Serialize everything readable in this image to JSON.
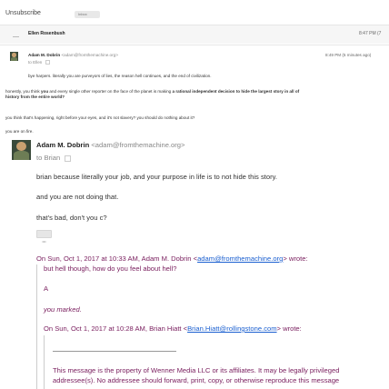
{
  "toolbar": {
    "unsubscribe_label": "Unsubscribe",
    "label_chip": "Inbox"
  },
  "collapsed_message": {
    "sender": "Ellen Rosenbush",
    "time": "8:47 PM (7"
  },
  "message1": {
    "sender": "Adam M. Dobrin",
    "email": "<adam@fromthemachine.org>",
    "time": "8:49 PM (5 minutes ago)",
    "to": "to Ellen",
    "body": "bye harpers. literally you are purveyors of lies, the reason hell continues, and the end of civilization."
  },
  "middle_text": {
    "p1a": "honestly, you think ",
    "p1b": "you",
    "p1c": " and every single other reporter on the face of the planet is making ",
    "p1d": "a rational independent decision to hide the largest story in all of",
    "p1e": "history from the entire world?",
    "p2": "you think that's happening, right before your eyes, and it's not slavery?  you should do nothing about it?",
    "p3": "you are on fire."
  },
  "message2": {
    "sender": "Adam M. Dobrin",
    "email": "<adam@fromthemachine.org>",
    "to": "to Brian",
    "lines": [
      "brian because literally your job, and your purpose in life is to not hide this story.",
      "and you are not doing that.",
      "that's bad, don't you c?"
    ],
    "expand": "•••"
  },
  "quoted": {
    "attr1_prefix": "On Sun, Oct 1, 2017 at 10:33 AM, Adam M. Dobrin <",
    "attr1_link": "adam@fromthemachine.org",
    "attr1_suffix": "> wrote:",
    "l1": "but hell though, how do you feel about hell?",
    "l2": "A",
    "l3": "you marked.",
    "attr2_prefix": "On Sun, Oct 1, 2017 at 10:28 AM, Brian Hiatt <",
    "attr2_link": "Brian.Hiatt@rollingstone.com",
    "attr2_suffix": "> wrote:",
    "disclaimer1": "This message is the property of Wenner Media LLC or its affiliates. It may be legally privileged",
    "disclaimer2": "addressee(s). No addressee should forward, print, copy, or otherwise reproduce this message"
  },
  "colors": {
    "link": "#1a5fd0",
    "quote": "#7b2160"
  }
}
